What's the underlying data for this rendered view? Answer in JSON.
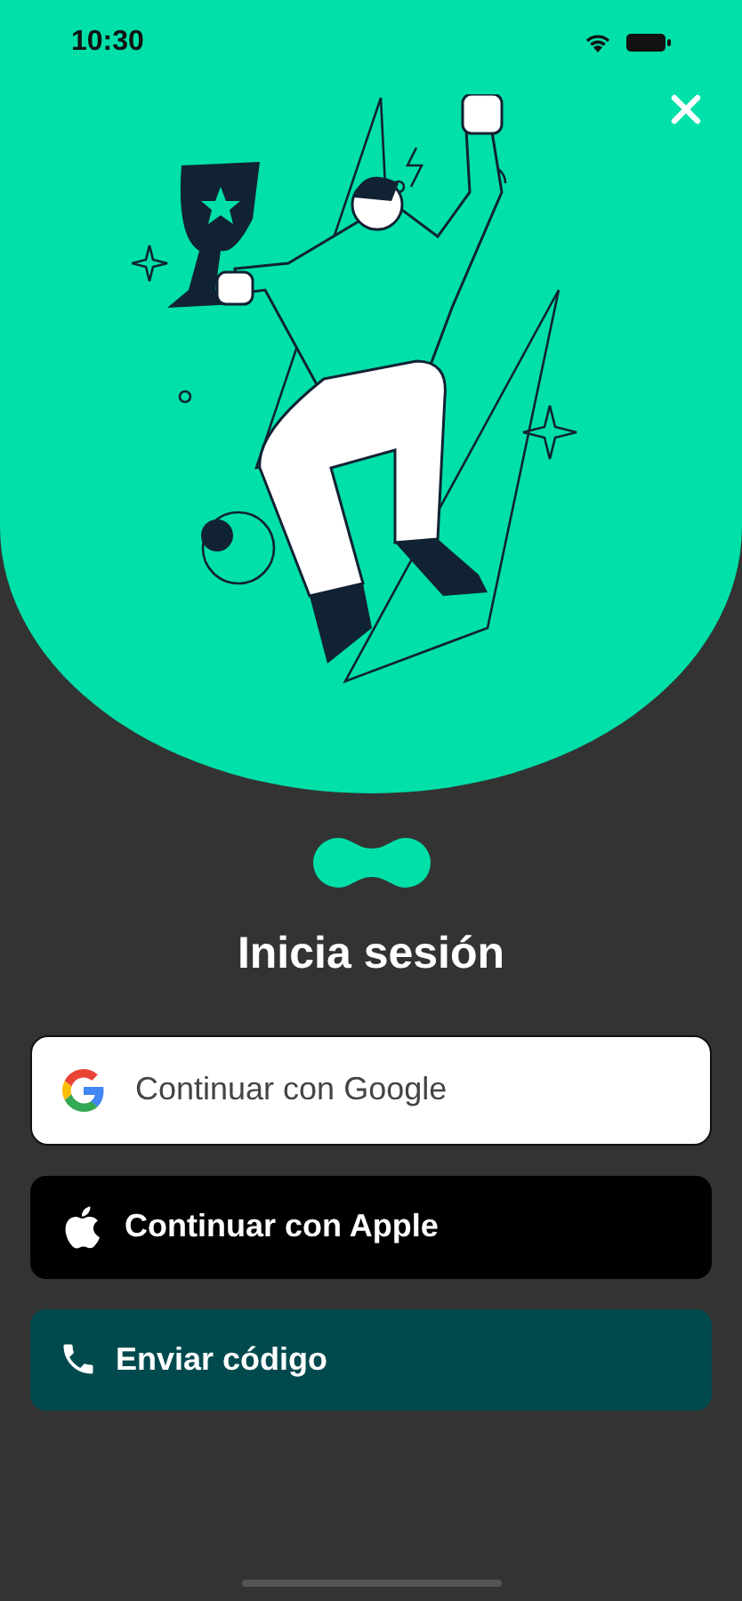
{
  "status_bar": {
    "time": "10:30"
  },
  "title": "Inicia sesión",
  "buttons": [
    {
      "kind": "google",
      "label": "Continuar con Google"
    },
    {
      "kind": "apple",
      "label": "Continuar con Apple"
    },
    {
      "kind": "phone",
      "label": "Enviar código"
    }
  ]
}
